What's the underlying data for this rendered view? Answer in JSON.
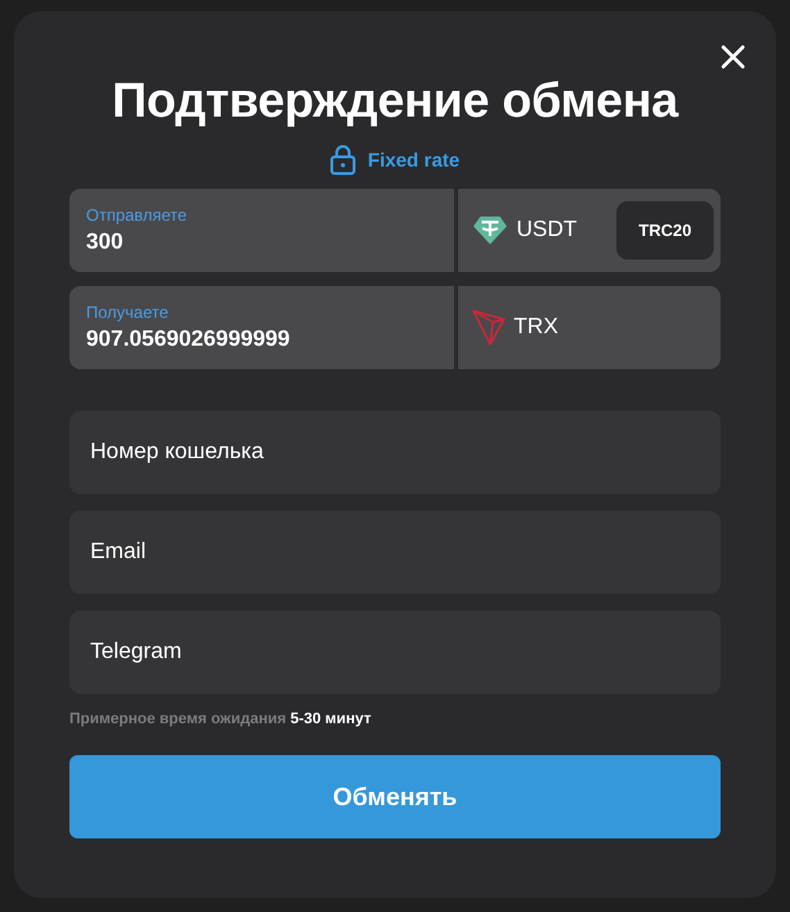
{
  "title": "Подтверждение обмена",
  "rate": {
    "label": "Fixed rate",
    "locked": true
  },
  "exchange": [
    {
      "label": "Отправляете",
      "amount": "300",
      "currency": "USDT",
      "network": "TRC20"
    },
    {
      "label": "Получаете",
      "amount": "907.0569026999999",
      "currency": "TRX"
    }
  ],
  "fields": [
    {
      "placeholder": "Номер кошелька"
    },
    {
      "placeholder": "Email"
    },
    {
      "placeholder": "Telegram"
    }
  ],
  "hint": "Примерное время ожидания **5-30 минут**",
  "submit": "Обменять"
}
